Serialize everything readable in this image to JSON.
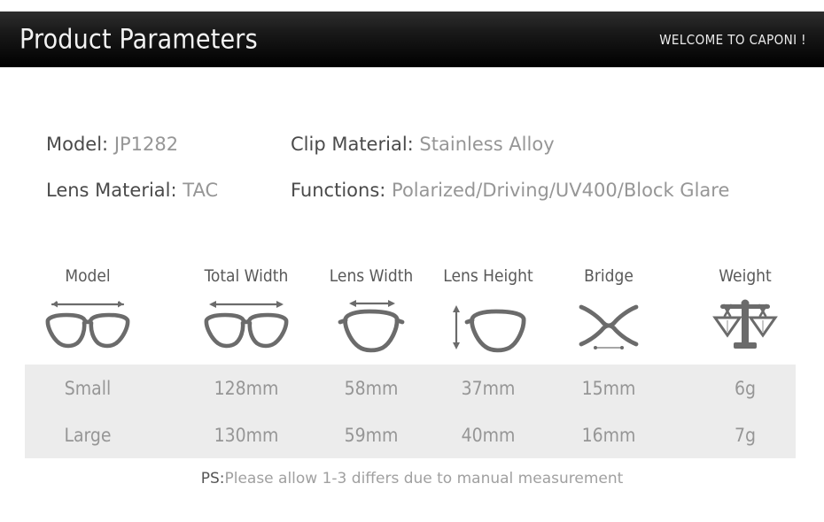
{
  "header": {
    "title": "Product Parameters",
    "welcome": "WELCOME TO CAPONI !",
    "background_color": "#000000",
    "text_color": "#f2f2f2"
  },
  "specs": {
    "label_color": "#4a4a4a",
    "value_color": "#969696",
    "items": [
      {
        "label": "Model:",
        "value": "JP1282",
        "column": "left",
        "row": 1
      },
      {
        "label": "Clip Material:",
        "value": "Stainless Alloy",
        "column": "right",
        "row": 1
      },
      {
        "label": "Lens Material:",
        "value": "TAC",
        "column": "left",
        "row": 2
      },
      {
        "label": "Functions:",
        "value": "Polarized/Driving/UV400/Block Glare",
        "column": "right",
        "row": 2
      }
    ]
  },
  "table": {
    "band_color": "#ececec",
    "headers": [
      "Model",
      "Total Width",
      "Lens Width",
      "Lens Height",
      "Bridge",
      "Weight"
    ],
    "icons": [
      "glasses-full-width-icon",
      "glasses-total-width-icon",
      "lens-width-icon",
      "lens-height-icon",
      "bridge-icon",
      "weight-scale-icon"
    ],
    "rows": [
      {
        "size": "Small",
        "total_width": "128mm",
        "lens_width": "58mm",
        "lens_height": "37mm",
        "bridge": "15mm",
        "weight": "6g"
      },
      {
        "size": "Large",
        "total_width": "130mm",
        "lens_width": "59mm",
        "lens_height": "40mm",
        "bridge": "16mm",
        "weight": "7g"
      }
    ]
  },
  "footer": {
    "prefix": "PS:",
    "note": "Please allow 1-3 differs due to manual measurement"
  }
}
